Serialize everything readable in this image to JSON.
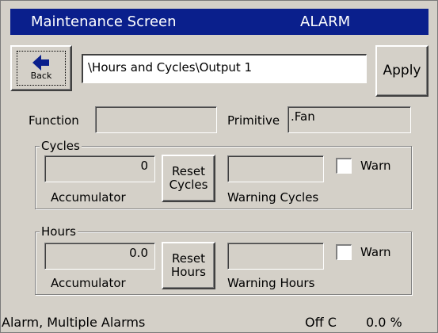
{
  "window": {
    "title": "Maintenance Screen",
    "alarm_label": "ALARM"
  },
  "toolbar": {
    "back_label": "Back",
    "back_icon": "left-arrow-icon",
    "path_value": "\\Hours and Cycles\\Output 1",
    "apply_label": "Apply"
  },
  "info": {
    "function_label": "Function",
    "function_value": "",
    "primitive_label": "Primitive",
    "primitive_value": ".Fan"
  },
  "cycles": {
    "group_title": "Cycles",
    "accumulator_value": "0",
    "accumulator_label": "Accumulator",
    "reset_label_line1": "Reset",
    "reset_label_line2": "Cycles",
    "warning_value": "",
    "warning_label": "Warning Cycles",
    "warn_label": "Warn",
    "warn_checked": false
  },
  "hours": {
    "group_title": "Hours",
    "accumulator_value": "0.0",
    "accumulator_label": "Accumulator",
    "reset_label_line1": "Reset",
    "reset_label_line2": "Hours",
    "warning_value": "",
    "warning_label": "Warning Hours",
    "warn_label": "Warn",
    "warn_checked": false
  },
  "status_bar": {
    "alarm_text": "Alarm, Multiple Alarms",
    "state_text": "Off C",
    "percent_text": "0.0 %"
  },
  "colors": {
    "titlebar": "#0a1f8c",
    "face": "#d4d0c8"
  }
}
